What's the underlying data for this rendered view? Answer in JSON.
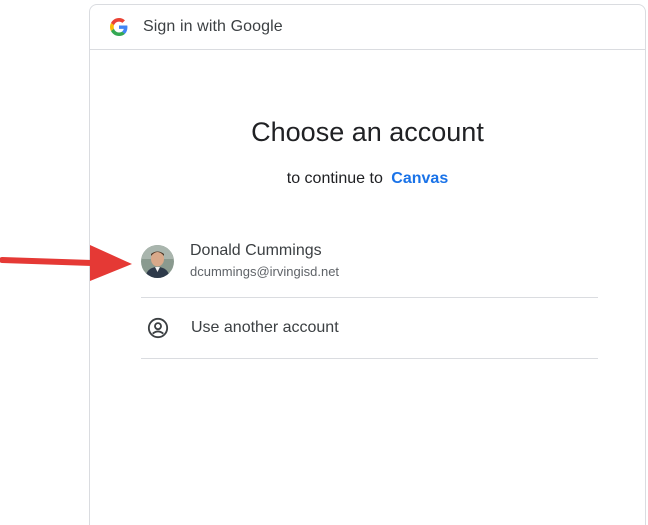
{
  "header": {
    "title": "Sign in with Google",
    "logo_icon": "google-g-icon"
  },
  "main": {
    "heading": "Choose an account",
    "subheading_prefix": "to continue to",
    "app_name": "Canvas"
  },
  "accounts": [
    {
      "name": "Donald Cummings",
      "email": "dcummings@irvingisd.net",
      "avatar_icon": "avatar"
    }
  ],
  "another_account": {
    "label": "Use another account",
    "icon": "account-circle-icon"
  },
  "annotation": {
    "arrow_color": "#e53935"
  },
  "colors": {
    "accent": "#1a73e8",
    "divider": "#dadce0",
    "text_primary": "#202124",
    "text_secondary": "#5f6368"
  }
}
